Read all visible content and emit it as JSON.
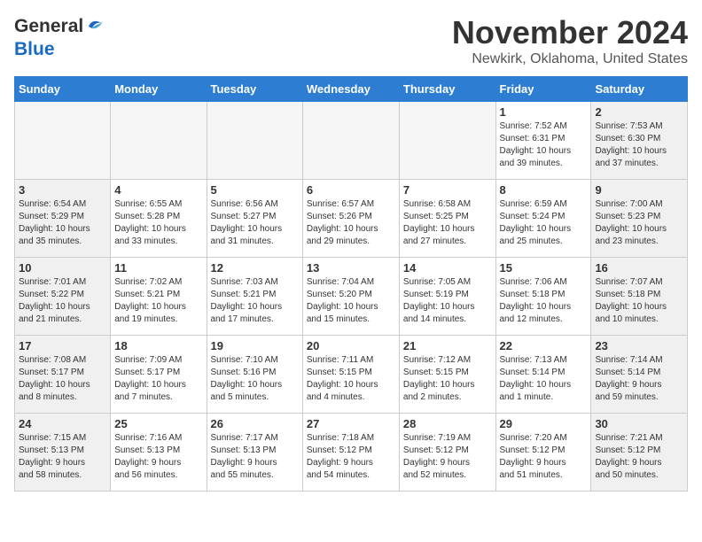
{
  "header": {
    "logo_general": "General",
    "logo_blue": "Blue",
    "month": "November 2024",
    "location": "Newkirk, Oklahoma, United States"
  },
  "weekdays": [
    "Sunday",
    "Monday",
    "Tuesday",
    "Wednesday",
    "Thursday",
    "Friday",
    "Saturday"
  ],
  "weeks": [
    [
      {
        "day": "",
        "info": ""
      },
      {
        "day": "",
        "info": ""
      },
      {
        "day": "",
        "info": ""
      },
      {
        "day": "",
        "info": ""
      },
      {
        "day": "",
        "info": ""
      },
      {
        "day": "1",
        "info": "Sunrise: 7:52 AM\nSunset: 6:31 PM\nDaylight: 10 hours\nand 39 minutes."
      },
      {
        "day": "2",
        "info": "Sunrise: 7:53 AM\nSunset: 6:30 PM\nDaylight: 10 hours\nand 37 minutes."
      }
    ],
    [
      {
        "day": "3",
        "info": "Sunrise: 6:54 AM\nSunset: 5:29 PM\nDaylight: 10 hours\nand 35 minutes."
      },
      {
        "day": "4",
        "info": "Sunrise: 6:55 AM\nSunset: 5:28 PM\nDaylight: 10 hours\nand 33 minutes."
      },
      {
        "day": "5",
        "info": "Sunrise: 6:56 AM\nSunset: 5:27 PM\nDaylight: 10 hours\nand 31 minutes."
      },
      {
        "day": "6",
        "info": "Sunrise: 6:57 AM\nSunset: 5:26 PM\nDaylight: 10 hours\nand 29 minutes."
      },
      {
        "day": "7",
        "info": "Sunrise: 6:58 AM\nSunset: 5:25 PM\nDaylight: 10 hours\nand 27 minutes."
      },
      {
        "day": "8",
        "info": "Sunrise: 6:59 AM\nSunset: 5:24 PM\nDaylight: 10 hours\nand 25 minutes."
      },
      {
        "day": "9",
        "info": "Sunrise: 7:00 AM\nSunset: 5:23 PM\nDaylight: 10 hours\nand 23 minutes."
      }
    ],
    [
      {
        "day": "10",
        "info": "Sunrise: 7:01 AM\nSunset: 5:22 PM\nDaylight: 10 hours\nand 21 minutes."
      },
      {
        "day": "11",
        "info": "Sunrise: 7:02 AM\nSunset: 5:21 PM\nDaylight: 10 hours\nand 19 minutes."
      },
      {
        "day": "12",
        "info": "Sunrise: 7:03 AM\nSunset: 5:21 PM\nDaylight: 10 hours\nand 17 minutes."
      },
      {
        "day": "13",
        "info": "Sunrise: 7:04 AM\nSunset: 5:20 PM\nDaylight: 10 hours\nand 15 minutes."
      },
      {
        "day": "14",
        "info": "Sunrise: 7:05 AM\nSunset: 5:19 PM\nDaylight: 10 hours\nand 14 minutes."
      },
      {
        "day": "15",
        "info": "Sunrise: 7:06 AM\nSunset: 5:18 PM\nDaylight: 10 hours\nand 12 minutes."
      },
      {
        "day": "16",
        "info": "Sunrise: 7:07 AM\nSunset: 5:18 PM\nDaylight: 10 hours\nand 10 minutes."
      }
    ],
    [
      {
        "day": "17",
        "info": "Sunrise: 7:08 AM\nSunset: 5:17 PM\nDaylight: 10 hours\nand 8 minutes."
      },
      {
        "day": "18",
        "info": "Sunrise: 7:09 AM\nSunset: 5:17 PM\nDaylight: 10 hours\nand 7 minutes."
      },
      {
        "day": "19",
        "info": "Sunrise: 7:10 AM\nSunset: 5:16 PM\nDaylight: 10 hours\nand 5 minutes."
      },
      {
        "day": "20",
        "info": "Sunrise: 7:11 AM\nSunset: 5:15 PM\nDaylight: 10 hours\nand 4 minutes."
      },
      {
        "day": "21",
        "info": "Sunrise: 7:12 AM\nSunset: 5:15 PM\nDaylight: 10 hours\nand 2 minutes."
      },
      {
        "day": "22",
        "info": "Sunrise: 7:13 AM\nSunset: 5:14 PM\nDaylight: 10 hours\nand 1 minute."
      },
      {
        "day": "23",
        "info": "Sunrise: 7:14 AM\nSunset: 5:14 PM\nDaylight: 9 hours\nand 59 minutes."
      }
    ],
    [
      {
        "day": "24",
        "info": "Sunrise: 7:15 AM\nSunset: 5:13 PM\nDaylight: 9 hours\nand 58 minutes."
      },
      {
        "day": "25",
        "info": "Sunrise: 7:16 AM\nSunset: 5:13 PM\nDaylight: 9 hours\nand 56 minutes."
      },
      {
        "day": "26",
        "info": "Sunrise: 7:17 AM\nSunset: 5:13 PM\nDaylight: 9 hours\nand 55 minutes."
      },
      {
        "day": "27",
        "info": "Sunrise: 7:18 AM\nSunset: 5:12 PM\nDaylight: 9 hours\nand 54 minutes."
      },
      {
        "day": "28",
        "info": "Sunrise: 7:19 AM\nSunset: 5:12 PM\nDaylight: 9 hours\nand 52 minutes."
      },
      {
        "day": "29",
        "info": "Sunrise: 7:20 AM\nSunset: 5:12 PM\nDaylight: 9 hours\nand 51 minutes."
      },
      {
        "day": "30",
        "info": "Sunrise: 7:21 AM\nSunset: 5:12 PM\nDaylight: 9 hours\nand 50 minutes."
      }
    ]
  ]
}
